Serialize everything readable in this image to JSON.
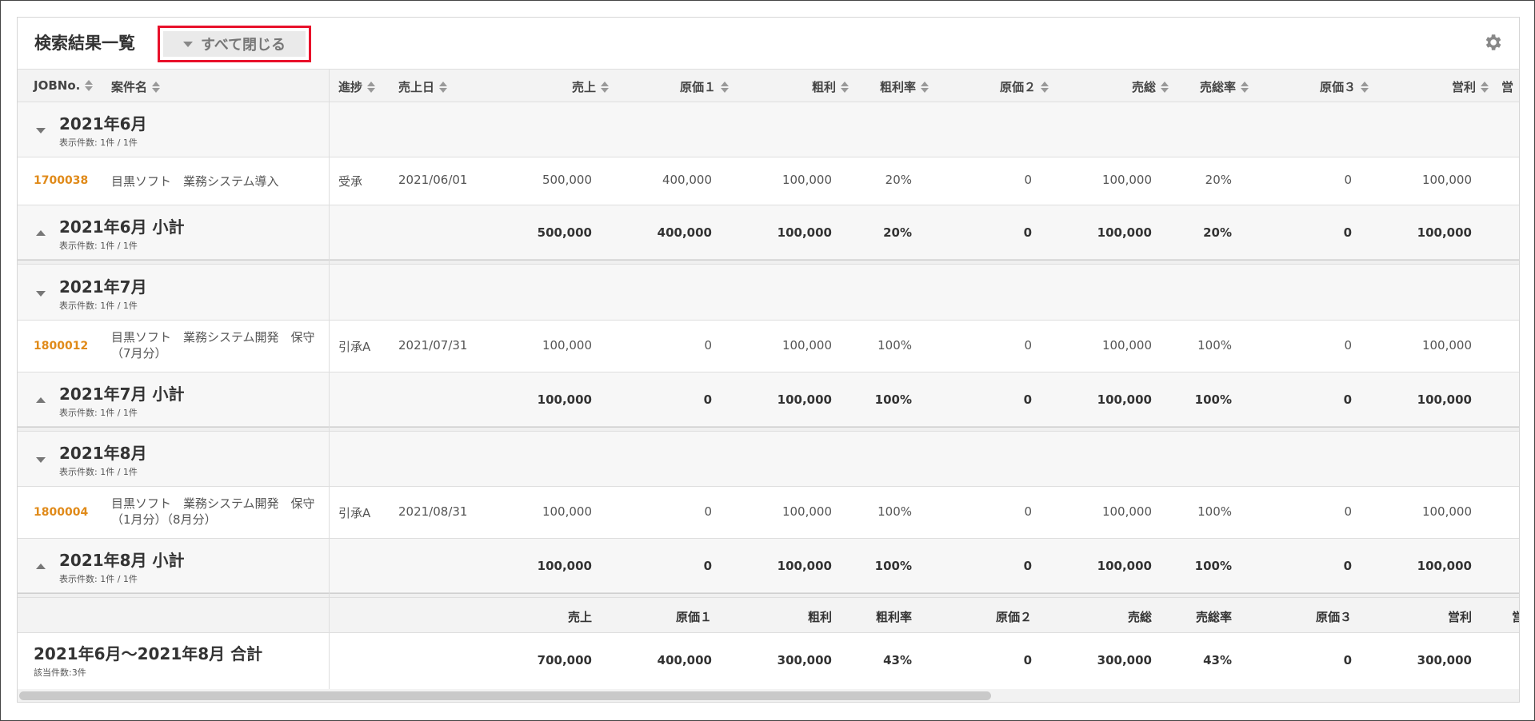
{
  "panel": {
    "title": "検索結果一覧",
    "collapse_all_label": "すべて閉じる",
    "settings_icon": "gear-icon"
  },
  "columns": [
    "JOBNo.",
    "案件名",
    "進捗",
    "売上日",
    "売上",
    "原価１",
    "粗利",
    "粗利率",
    "原価２",
    "売総",
    "売総率",
    "原価３",
    "営利",
    "営"
  ],
  "groups": [
    {
      "title": "2021年6月",
      "count": "表示件数: 1件 / 1件",
      "item": {
        "job": "1700038",
        "name": "目黒ソフト　業務システム導入",
        "status": "受承",
        "date": "2021/06/01",
        "sales": "500,000",
        "cost1": "400,000",
        "gross": "100,000",
        "gross_rate": "20%",
        "cost2": "0",
        "total": "100,000",
        "total_rate": "20%",
        "cost3": "0",
        "operating": "100,000"
      },
      "subtotal": {
        "title": "2021年6月 小計",
        "count": "表示件数: 1件 / 1件",
        "sales": "500,000",
        "cost1": "400,000",
        "gross": "100,000",
        "gross_rate": "20%",
        "cost2": "0",
        "total": "100,000",
        "total_rate": "20%",
        "cost3": "0",
        "operating": "100,000"
      }
    },
    {
      "title": "2021年7月",
      "count": "表示件数: 1件 / 1件",
      "item": {
        "job": "1800012",
        "name": "目黒ソフト　業務システム開発　保守（7月分）",
        "status": "引承A",
        "date": "2021/07/31",
        "sales": "100,000",
        "cost1": "0",
        "gross": "100,000",
        "gross_rate": "100%",
        "cost2": "0",
        "total": "100,000",
        "total_rate": "100%",
        "cost3": "0",
        "operating": "100,000"
      },
      "subtotal": {
        "title": "2021年7月 小計",
        "count": "表示件数: 1件 / 1件",
        "sales": "100,000",
        "cost1": "0",
        "gross": "100,000",
        "gross_rate": "100%",
        "cost2": "0",
        "total": "100,000",
        "total_rate": "100%",
        "cost3": "0",
        "operating": "100,000"
      }
    },
    {
      "title": "2021年8月",
      "count": "表示件数: 1件 / 1件",
      "item": {
        "job": "1800004",
        "name": "目黒ソフト　業務システム開発　保守（1月分）（8月分）",
        "status": "引承A",
        "date": "2021/08/31",
        "sales": "100,000",
        "cost1": "0",
        "gross": "100,000",
        "gross_rate": "100%",
        "cost2": "0",
        "total": "100,000",
        "total_rate": "100%",
        "cost3": "0",
        "operating": "100,000"
      },
      "subtotal": {
        "title": "2021年8月 小計",
        "count": "表示件数: 1件 / 1件",
        "sales": "100,000",
        "cost1": "0",
        "gross": "100,000",
        "gross_rate": "100%",
        "cost2": "0",
        "total": "100,000",
        "total_rate": "100%",
        "cost3": "0",
        "operating": "100,000"
      }
    }
  ],
  "grand_total": {
    "headers": [
      "売上",
      "原価１",
      "粗利",
      "粗利率",
      "原価２",
      "売総",
      "売総率",
      "原価３",
      "営利",
      "営"
    ],
    "title": "2021年6月～2021年8月 合計",
    "count": "該当件数:3件",
    "sales": "700,000",
    "cost1": "400,000",
    "gross": "300,000",
    "gross_rate": "43%",
    "cost2": "0",
    "total": "300,000",
    "total_rate": "43%",
    "cost3": "0",
    "operating": "300,000"
  },
  "colors": {
    "job_link": "#e08a19",
    "highlight_border": "#e8102a"
  }
}
